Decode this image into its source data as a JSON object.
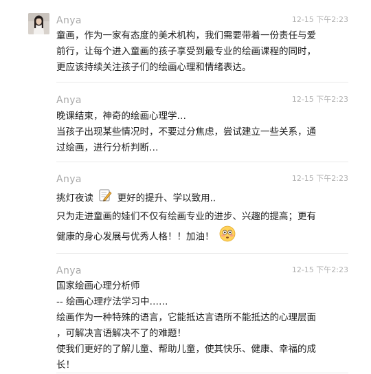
{
  "messages": [
    {
      "sender": "Anya",
      "time": "12-15 下午2:23",
      "lines": [
        "童画，作为一家有态度的美术机构，我们需要带着一份责任与爱",
        "前行，让每个进入童画的孩子享受到最专业的绘画课程的同时，",
        "更应该持续关注孩子们的绘画心理和情绪表达。"
      ]
    },
    {
      "sender": "Anya",
      "time": "12-15 下午2:23",
      "lines": [
        "晚课结束，神奇的绘画心理学…",
        "当孩子出现某些情况时，不要过分焦虑，尝试建立一些关系，通",
        "过绘画，进行分析判断…"
      ]
    },
    {
      "sender": "Anya",
      "time": "12-15 下午2:23",
      "line1_before": "挑灯夜读",
      "line1_after": "更好的提升、学以致用..",
      "line2": "只为走进童画的娃们不仅有绘画专业的进步、兴趣的提高；更有",
      "line3": "健康的身心发展与优秀人格！！加油！",
      "emoji_memo": "memo-emoji",
      "emoji_face": "flushed-face-emoji"
    },
    {
      "sender": "Anya",
      "time": "12-15 下午2:23",
      "lines": [
        "国家绘画心理分析师",
        "-- 绘画心理疗法学习中……",
        "绘画作为一种特殊的语言，它能抵达言语所不能抵达的心理层面",
        "，可解决言语解决不了的难题！",
        "使我们更好的了解儿童、帮助儿童，使其快乐、健康、幸福的成",
        "长！"
      ]
    }
  ]
}
